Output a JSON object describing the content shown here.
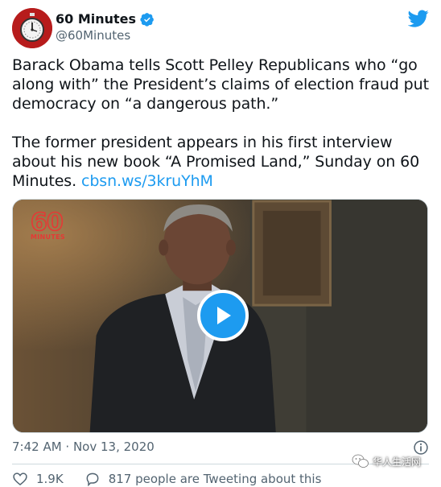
{
  "account": {
    "display_name": "60 Minutes",
    "handle": "@60Minutes",
    "verified": true
  },
  "tweet": {
    "paragraph1": "Barack Obama tells Scott Pelley Republicans who “go along with” the President’s claims of election fraud put democracy on “a dangerous path.”",
    "paragraph2": "The former president appears in his first interview about his new book “A Promised Land,” Sunday on 60 Minutes.",
    "link": "cbsn.ws/3kruYhM"
  },
  "media": {
    "logo_number": "60",
    "logo_word": "MINUTES",
    "type": "video"
  },
  "meta": {
    "timestamp": "7:42 AM · Nov 13, 2020"
  },
  "actions": {
    "likes": "1.9K",
    "conversation": "817 people are Tweeting about this"
  },
  "watermark": {
    "text": "华人生活网"
  },
  "colors": {
    "accent": "#1d9bf0",
    "secondary_text": "#536471",
    "avatar_bg": "#b71c1c",
    "logo_red": "#e53935"
  },
  "icons": [
    "verified-badge-icon",
    "twitter-bird-icon",
    "play-icon",
    "info-icon",
    "heart-icon",
    "chat-bubble-icon",
    "wechat-icon"
  ]
}
